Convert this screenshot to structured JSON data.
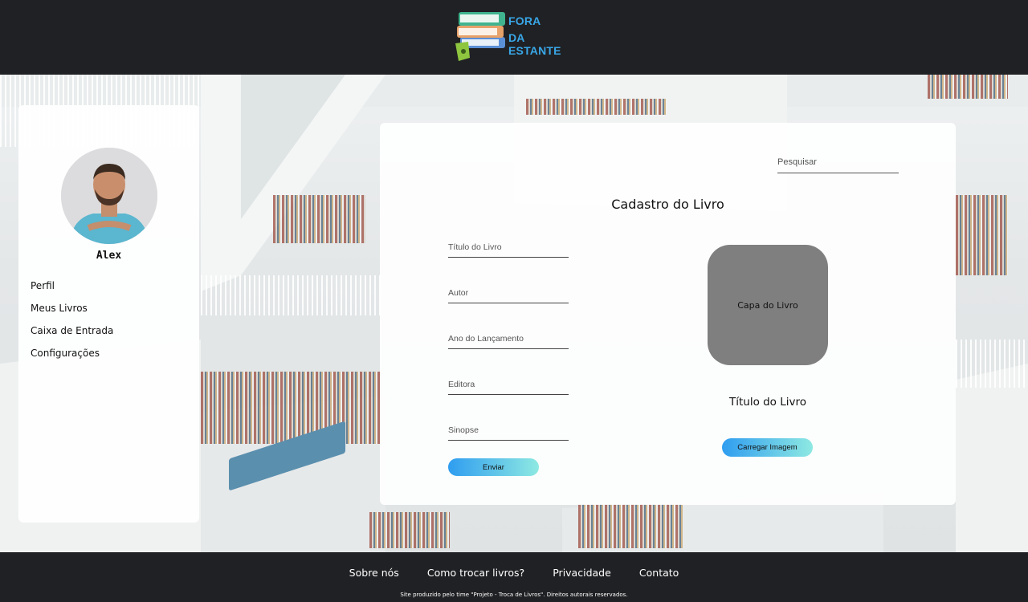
{
  "header": {
    "logo_line1": "FORA",
    "logo_line2": "DA ESTANTE"
  },
  "sidebar": {
    "username": "Alex",
    "menu": [
      {
        "label": "Perfil"
      },
      {
        "label": "Meus Livros"
      },
      {
        "label": "Caixa de Entrada"
      },
      {
        "label": "Configurações"
      }
    ]
  },
  "main": {
    "search_placeholder": "Pesquisar",
    "title": "Cadastro do Livro",
    "fields": {
      "titulo": "Título do Livro",
      "autor": "Autor",
      "ano": "Ano do Lançamento",
      "editora": "Editora",
      "sinopse": "Sinopse"
    },
    "send_label": "Enviar",
    "cover_label": "Capa do Livro",
    "book_title": "Título do Livro",
    "upload_label": "Carregar Imagem"
  },
  "footer": {
    "links": [
      {
        "label": "Sobre nós"
      },
      {
        "label": "Como trocar livros?"
      },
      {
        "label": "Privacidade"
      },
      {
        "label": "Contato"
      }
    ],
    "copyright": "Site produzido pelo time \"Projeto - Troca de Livros\". Direitos autorais reservados."
  },
  "colors": {
    "header_bg": "#202124",
    "logo_blue": "#39a7e8",
    "button_gradient_start": "#2f9df0",
    "button_gradient_end": "#8ee9e2",
    "cover_gray": "#7f7f7f"
  }
}
